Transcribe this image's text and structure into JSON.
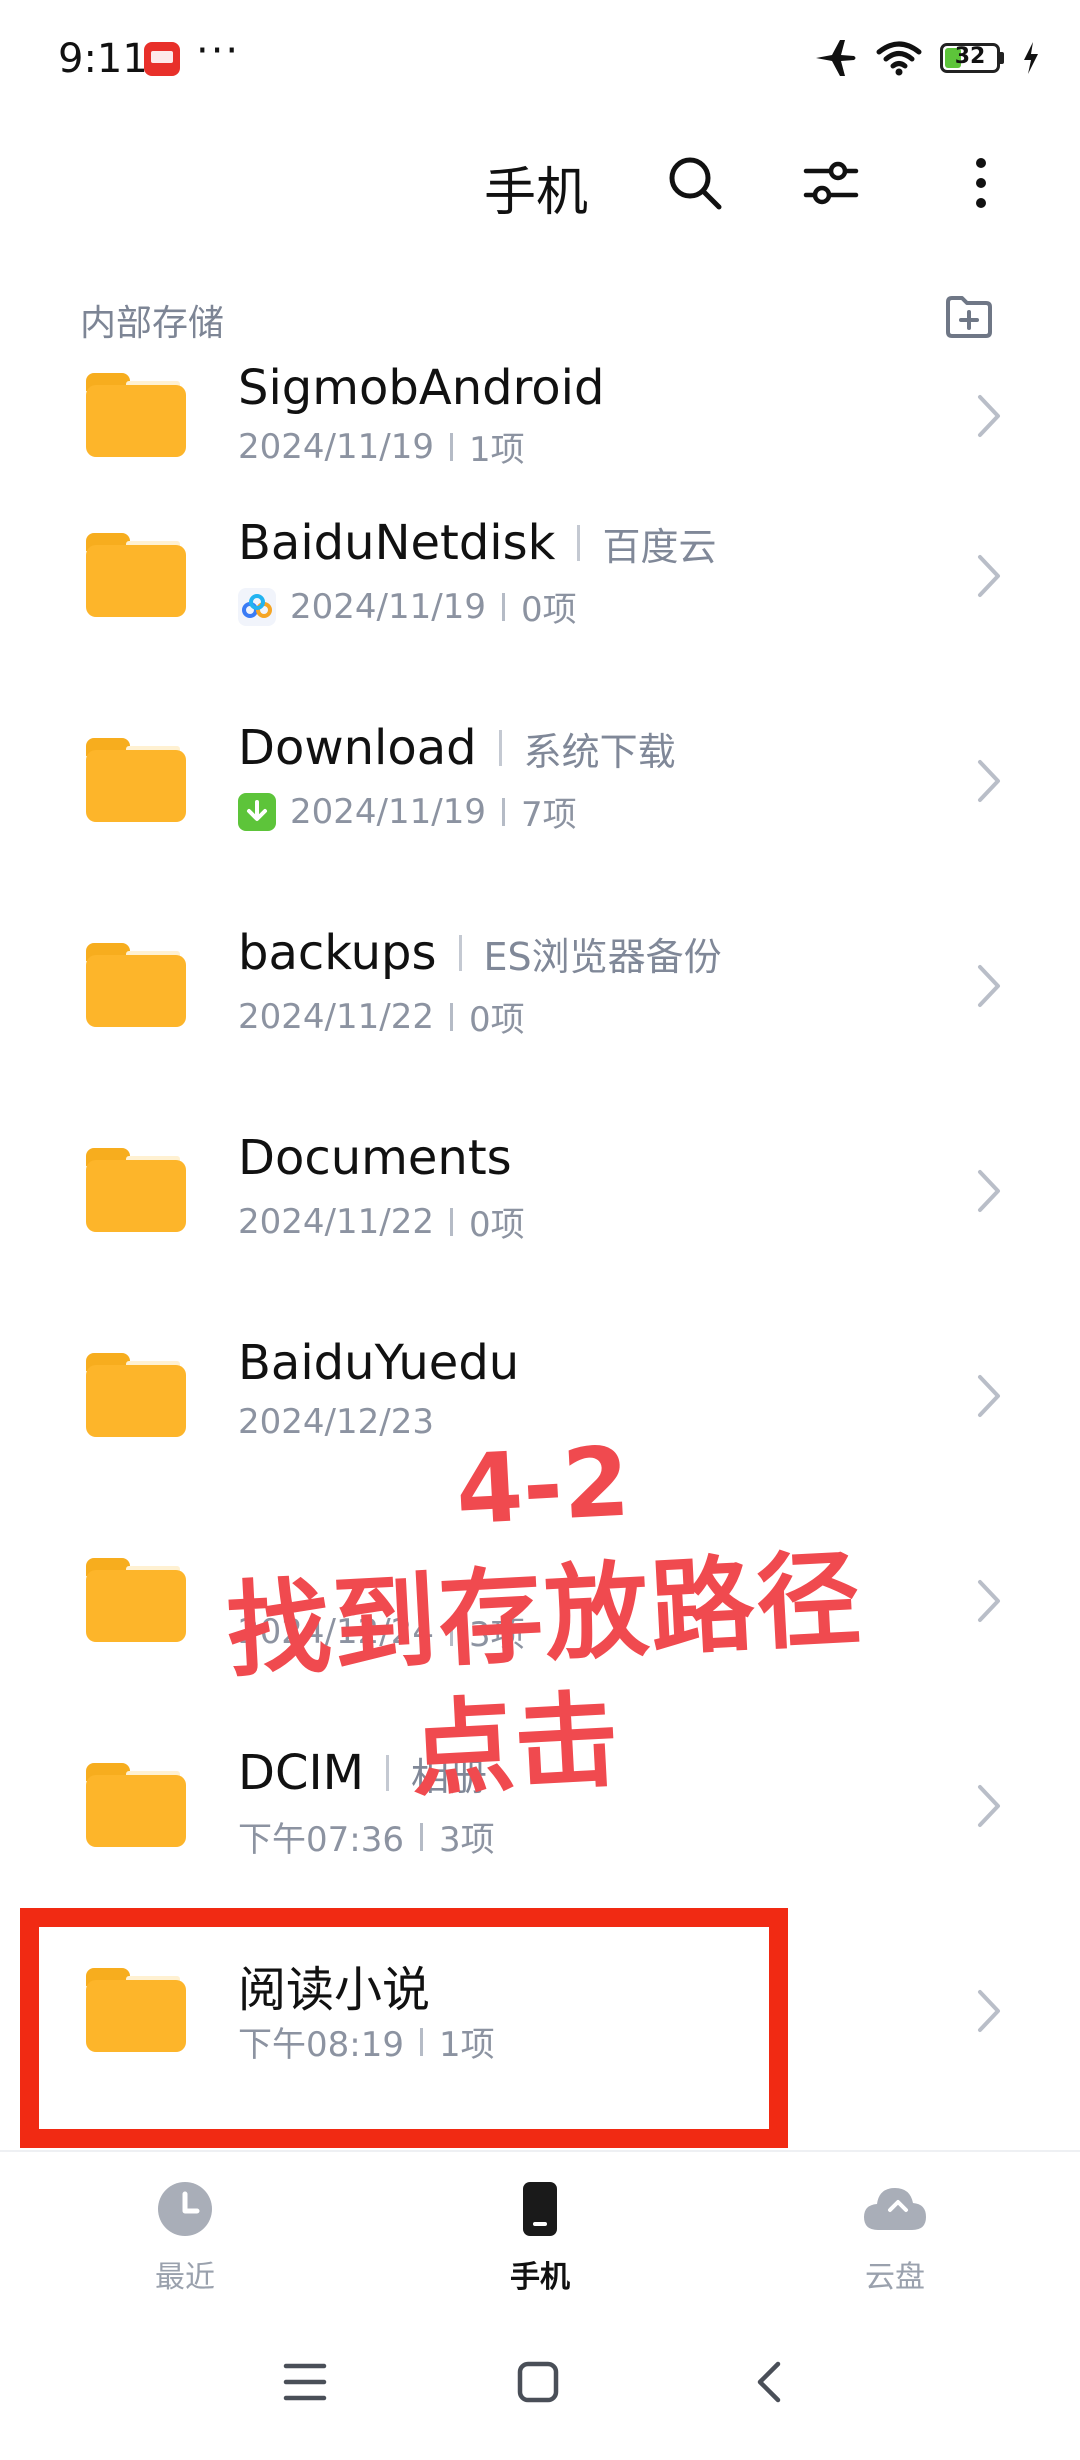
{
  "status_bar": {
    "time": "9:11",
    "more": "···",
    "battery_level": "32"
  },
  "header": {
    "title": "手机"
  },
  "breadcrumb": {
    "path": "内部存储"
  },
  "folders": [
    {
      "name": "SigmobAndroid",
      "alias": "",
      "date": "2024/11/19",
      "count": "1项",
      "meta_icon": ""
    },
    {
      "name": "BaiduNetdisk",
      "alias": "百度云",
      "date": "2024/11/19",
      "count": "0项",
      "meta_icon": "baidu-netdisk-icon"
    },
    {
      "name": "Download",
      "alias": "系统下载",
      "date": "2024/11/19",
      "count": "7项",
      "meta_icon": "download-icon"
    },
    {
      "name": "backups",
      "alias": "ES浏览器备份",
      "date": "2024/11/22",
      "count": "0项",
      "meta_icon": ""
    },
    {
      "name": "Documents",
      "alias": "",
      "date": "2024/11/22",
      "count": "0项",
      "meta_icon": ""
    },
    {
      "name": "BaiduYuedu",
      "alias": "",
      "date": "2024/12/23",
      "count": "",
      "meta_icon": ""
    },
    {
      "name": "",
      "alias": "",
      "date": "2024/12/24",
      "count": "3项",
      "meta_icon": ""
    },
    {
      "name": "DCIM",
      "alias": "相册",
      "date": "下午07:36",
      "count": "3项",
      "meta_icon": ""
    },
    {
      "name": "阅读小说",
      "alias": "",
      "date": "下午08:19",
      "count": "1项",
      "meta_icon": ""
    }
  ],
  "annotation": {
    "step": "4-2",
    "line1": "找到存放路径",
    "line2": "点击",
    "color": "#f04a4f"
  },
  "highlight_color": "#f12a13",
  "bottom_nav": [
    {
      "label": "最近",
      "icon": "clock-icon",
      "active": false
    },
    {
      "label": "手机",
      "icon": "phone-icon",
      "active": true
    },
    {
      "label": "云盘",
      "icon": "cloud-icon",
      "active": false
    }
  ],
  "accent": {
    "folder": "#fdb52a",
    "download_badge": "#5dc43a"
  }
}
